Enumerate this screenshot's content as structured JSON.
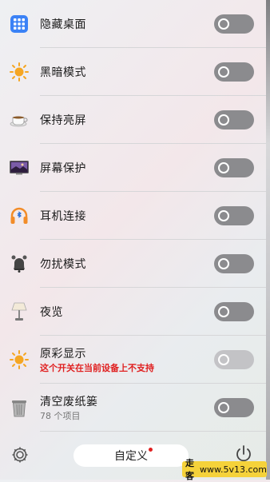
{
  "items": [
    {
      "label": "隐藏桌面",
      "icon": "app-grid-icon"
    },
    {
      "label": "黑暗模式",
      "icon": "sun-icon"
    },
    {
      "label": "保持亮屏",
      "icon": "coffee-cup-icon"
    },
    {
      "label": "屏幕保护",
      "icon": "screensaver-icon"
    },
    {
      "label": "耳机连接",
      "icon": "headphones-icon"
    },
    {
      "label": "勿扰模式",
      "icon": "bell-icon"
    },
    {
      "label": "夜览",
      "icon": "lamp-icon"
    },
    {
      "label": "原彩显示",
      "icon": "sun-icon",
      "note": "这个开关在当前设备上不支持"
    },
    {
      "label": "清空废纸篓",
      "icon": "trash-icon",
      "note": "78 个项目"
    }
  ],
  "toggles": [
    "off",
    "off",
    "off",
    "off",
    "off",
    "off",
    "off",
    "off-disabled",
    "off"
  ],
  "footer": {
    "customize_label": "自定义",
    "settings_icon": "gear-icon",
    "power_icon": "power-icon"
  },
  "watermark": {
    "mark": "走客",
    "site": "www.5v13.com"
  },
  "colors": {
    "toggle_off": "#8b8b8e",
    "toggle_disabled": "#c3c3c6",
    "warning": "#e02020"
  }
}
